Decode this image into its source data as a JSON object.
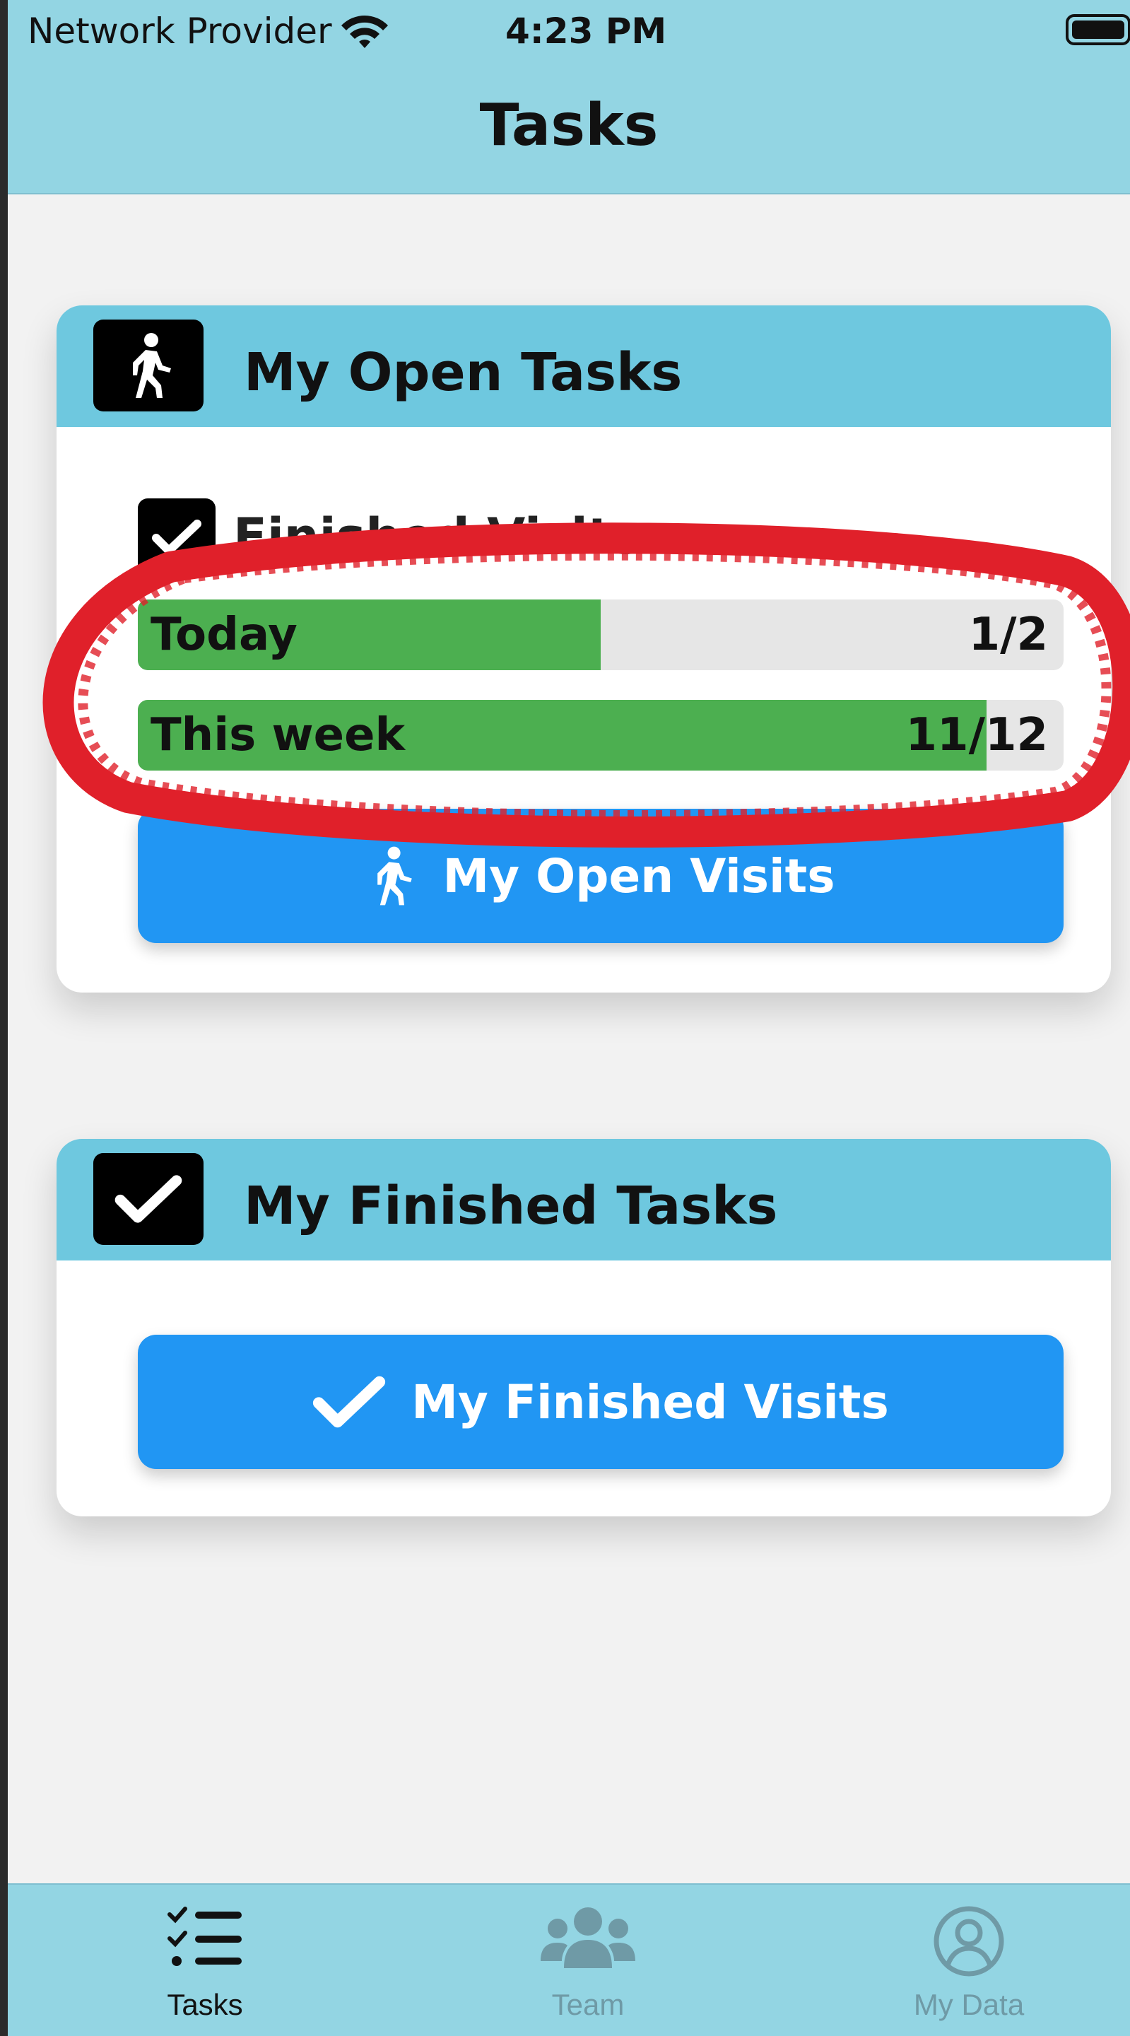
{
  "status_bar": {
    "carrier": "Network Provider",
    "time": "4:23 PM",
    "wifi_icon": "wifi-icon",
    "battery_icon": "battery-icon"
  },
  "header": {
    "title": "Tasks"
  },
  "open_tasks_card": {
    "title": "My Open Tasks",
    "icon": "walking-person-icon",
    "finished_visits_label": "Finished Visits",
    "progress": [
      {
        "label": "Today",
        "value_text": "1/2",
        "fraction": 0.5
      },
      {
        "label": "This week",
        "value_text": "11/12",
        "fraction": 0.917
      }
    ],
    "button": {
      "label": "My Open Visits",
      "icon": "walking-person-icon"
    }
  },
  "finished_tasks_card": {
    "title": "My Finished Tasks",
    "icon": "checkmark-icon",
    "button": {
      "label": "My Finished Visits",
      "icon": "checkmark-icon"
    }
  },
  "tab_bar": {
    "tabs": [
      {
        "label": "Tasks",
        "icon": "task-list-icon",
        "active": true
      },
      {
        "label": "Team",
        "icon": "team-icon",
        "active": false
      },
      {
        "label": "My Data",
        "icon": "user-circle-icon",
        "active": false
      }
    ]
  },
  "colors": {
    "header_bg": "#93d5e3",
    "card_header_bg": "#6ec8df",
    "progress_fill": "#4caf50",
    "button_bg": "#2196f3",
    "tab_active": "#111111",
    "tab_inactive": "#6f9aa6",
    "annotation": "#e0202a"
  }
}
